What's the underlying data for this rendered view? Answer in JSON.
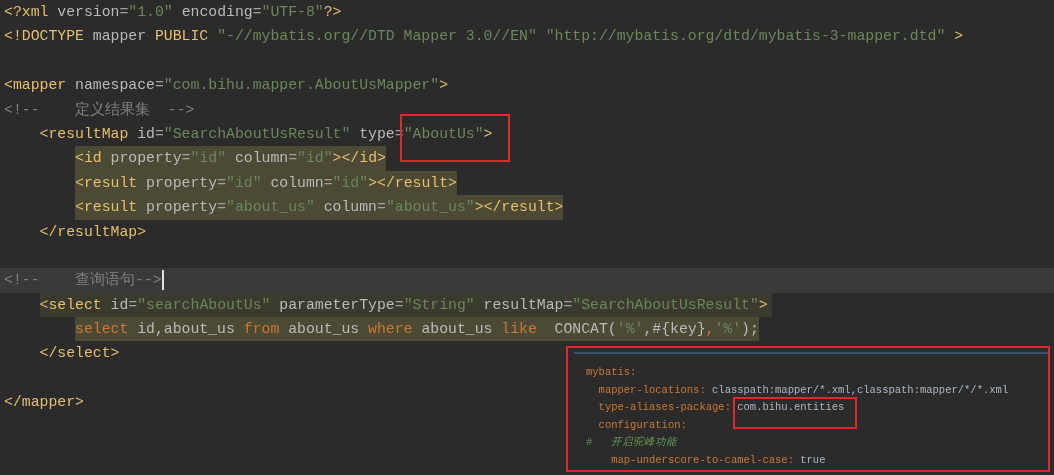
{
  "editor": {
    "lines": [
      {
        "kind": "root",
        "highlighted": false,
        "current": false,
        "matched": false,
        "tokens": [
          {
            "kind": "tag",
            "text": "<?xml "
          },
          {
            "kind": "attr",
            "text": "version"
          },
          {
            "kind": "punct",
            "text": "="
          },
          {
            "kind": "string",
            "text": "\"1.0\" "
          },
          {
            "kind": "attr",
            "text": "encoding"
          },
          {
            "kind": "punct",
            "text": "="
          },
          {
            "kind": "string",
            "text": "\"UTF-8\""
          },
          {
            "kind": "tag",
            "text": "?>"
          }
        ]
      },
      {
        "kind": "root",
        "highlighted": false,
        "current": false,
        "matched": false,
        "tokens": [
          {
            "kind": "tag",
            "text": "<!DOCTYPE "
          },
          {
            "kind": "attr",
            "text": "mapper "
          },
          {
            "kind": "tag",
            "text": "PUBLIC "
          },
          {
            "kind": "string",
            "text": "\"-//mybatis.org//DTD Mapper 3.0//EN\" \"http://mybatis.org/dtd/mybatis-3-mapper.dtd\" "
          },
          {
            "kind": "tag",
            "text": ">"
          }
        ]
      },
      {
        "kind": "root",
        "highlighted": false,
        "current": false,
        "matched": false
      },
      {
        "kind": "root",
        "highlighted": false,
        "current": false,
        "matched": false,
        "tokens": [
          {
            "kind": "tag",
            "text": "<mapper "
          },
          {
            "kind": "attr",
            "text": "namespace"
          },
          {
            "kind": "punct",
            "text": "="
          },
          {
            "kind": "string",
            "text": "\"com.bihu.mapper.AboutUsMapper\""
          },
          {
            "kind": "tag",
            "text": ">"
          }
        ]
      },
      {
        "kind": "root",
        "highlighted": false,
        "current": false,
        "matched": false,
        "tokens": [
          {
            "kind": "comment",
            "text": "<!--    定义结果集  -->"
          }
        ]
      },
      {
        "kind": "nested",
        "highlighted": false,
        "current": false,
        "matched": false,
        "tokens": [
          {
            "kind": "tag",
            "text": "<resultMap "
          },
          {
            "kind": "attr",
            "text": "id"
          },
          {
            "kind": "punct",
            "text": "="
          },
          {
            "kind": "string",
            "text": "\"SearchAboutUsResult\" "
          },
          {
            "kind": "attr",
            "text": "type"
          },
          {
            "kind": "punct",
            "text": "="
          },
          {
            "kind": "string",
            "text": "\"AboutUs\"",
            "boxed": true
          },
          {
            "kind": "tag",
            "text": ">"
          }
        ]
      },
      {
        "kind": "inner",
        "highlighted": true,
        "current": false,
        "matched": false,
        "tokens": [
          {
            "kind": "tag",
            "text": "<id "
          },
          {
            "kind": "attr",
            "text": "property"
          },
          {
            "kind": "punct",
            "text": "="
          },
          {
            "kind": "string",
            "text": "\"id\" "
          },
          {
            "kind": "attr",
            "text": "column"
          },
          {
            "kind": "punct",
            "text": "="
          },
          {
            "kind": "string",
            "text": "\"id\""
          },
          {
            "kind": "tag",
            "text": "></id>"
          }
        ]
      },
      {
        "kind": "inner",
        "highlighted": true,
        "current": false,
        "matched": false,
        "tokens": [
          {
            "kind": "tag",
            "text": "<result "
          },
          {
            "kind": "attr",
            "text": "property"
          },
          {
            "kind": "punct",
            "text": "="
          },
          {
            "kind": "string",
            "text": "\"id\" "
          },
          {
            "kind": "attr",
            "text": "column"
          },
          {
            "kind": "punct",
            "text": "="
          },
          {
            "kind": "string",
            "text": "\"id\""
          },
          {
            "kind": "tag",
            "text": "></result>"
          }
        ]
      },
      {
        "kind": "inner",
        "highlighted": true,
        "current": false,
        "matched": false,
        "tokens": [
          {
            "kind": "tag",
            "text": "<result "
          },
          {
            "kind": "attr",
            "text": "property"
          },
          {
            "kind": "punct",
            "text": "="
          },
          {
            "kind": "string",
            "text": "\"about_us\" "
          },
          {
            "kind": "attr",
            "text": "column"
          },
          {
            "kind": "punct",
            "text": "="
          },
          {
            "kind": "string",
            "text": "\"about_us\""
          },
          {
            "kind": "tag",
            "text": "></result>"
          }
        ]
      },
      {
        "kind": "nested",
        "highlighted": false,
        "current": false,
        "matched": false,
        "tokens": [
          {
            "kind": "tag",
            "text": "</resultMap>"
          }
        ]
      },
      {
        "kind": "root",
        "highlighted": false,
        "current": false,
        "matched": false
      },
      {
        "kind": "root",
        "highlighted": false,
        "current": true,
        "matched": false,
        "cursor": true,
        "tokens": [
          {
            "kind": "comment",
            "text": "<!--    查询语句-->"
          }
        ]
      },
      {
        "kind": "nested",
        "highlighted": false,
        "current": false,
        "matched": true,
        "tokens": [
          {
            "kind": "tag",
            "text": "<select "
          },
          {
            "kind": "attr",
            "text": "id"
          },
          {
            "kind": "punct",
            "text": "="
          },
          {
            "kind": "string",
            "text": "\"searchAboutUs\" "
          },
          {
            "kind": "attr",
            "text": "parameterType"
          },
          {
            "kind": "punct",
            "text": "="
          },
          {
            "kind": "string",
            "text": "\"String\" "
          },
          {
            "kind": "attr",
            "text": "resultMap"
          },
          {
            "kind": "punct",
            "text": "="
          },
          {
            "kind": "string",
            "text": "\"SearchAboutUsResult\""
          },
          {
            "kind": "tag",
            "text": ">"
          }
        ]
      },
      {
        "kind": "inner",
        "highlighted": true,
        "current": false,
        "matched": false,
        "tokens": [
          {
            "kind": "keyword",
            "text": "select "
          },
          {
            "kind": "attr",
            "text": "id,about_us "
          },
          {
            "kind": "keyword",
            "text": "from "
          },
          {
            "kind": "attr",
            "text": "about_us "
          },
          {
            "kind": "keyword",
            "text": "where "
          },
          {
            "kind": "attr",
            "text": "about_us "
          },
          {
            "kind": "keyword",
            "text": "like  "
          },
          {
            "kind": "attr",
            "text": "CONCAT("
          },
          {
            "kind": "string",
            "text": "'%'"
          },
          {
            "kind": "attr",
            "text": ",#{key}"
          },
          {
            "kind": "keyword",
            "text": ","
          },
          {
            "kind": "string",
            "text": "'%'"
          },
          {
            "kind": "attr",
            "text": ");"
          }
        ]
      },
      {
        "kind": "nested",
        "highlighted": false,
        "current": false,
        "matched": false,
        "tokens": [
          {
            "kind": "tag",
            "text": "</select>"
          }
        ]
      },
      {
        "kind": "root",
        "highlighted": false,
        "current": false,
        "matched": false
      },
      {
        "kind": "root",
        "highlighted": false,
        "current": false,
        "matched": false,
        "tokens": [
          {
            "kind": "tag",
            "text": "</mapper>"
          }
        ]
      }
    ]
  },
  "yaml_panel": {
    "lines": [
      {
        "kind": "root",
        "tokens": [
          {
            "kind": "key",
            "text": "mybatis"
          },
          {
            "kind": "punct",
            "text": ":"
          }
        ]
      },
      {
        "kind": "nested",
        "tokens": [
          {
            "kind": "key",
            "text": "mapper-locations"
          },
          {
            "kind": "punct",
            "text": ": "
          },
          {
            "kind": "value",
            "text": "classpath:mapper/*.xml,classpath:mapper/*/*.xml"
          }
        ]
      },
      {
        "kind": "nested",
        "tokens": [
          {
            "kind": "key",
            "text": "type-aliases-package"
          },
          {
            "kind": "punct",
            "text": ": "
          },
          {
            "kind": "value",
            "text": "com.bihu.entities",
            "boxed": true
          }
        ]
      },
      {
        "kind": "nested",
        "tokens": [
          {
            "kind": "key",
            "text": "configuration"
          },
          {
            "kind": "punct",
            "text": ":"
          }
        ]
      },
      {
        "kind": "root",
        "tokens": [
          {
            "kind": "hash",
            "text": "#"
          },
          {
            "kind": "comment",
            "text": "   开启驼峰功能"
          }
        ]
      },
      {
        "kind": "inner",
        "tokens": [
          {
            "kind": "key",
            "text": "map-underscore-to-camel-case"
          },
          {
            "kind": "punct",
            "text": ": "
          },
          {
            "kind": "value",
            "text": "true"
          }
        ]
      }
    ]
  }
}
